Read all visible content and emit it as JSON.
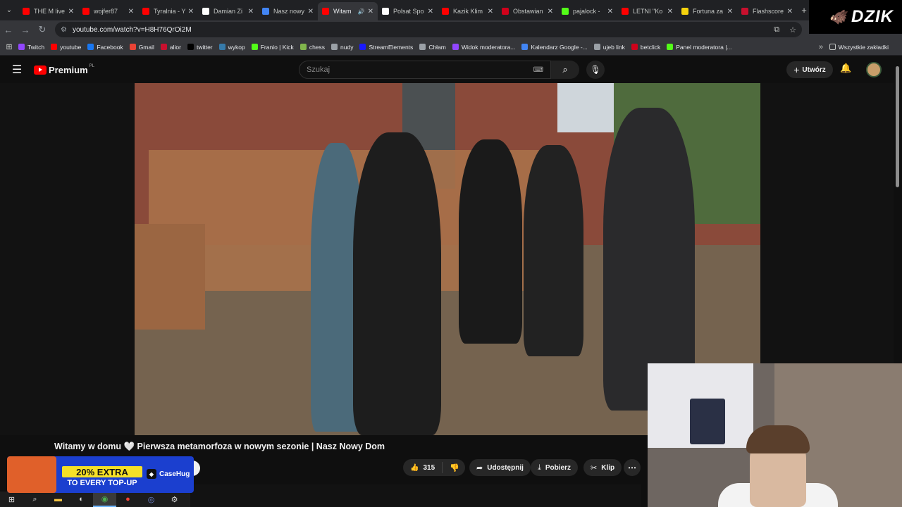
{
  "browser": {
    "tabs": [
      {
        "title": "THE M live",
        "icon": "youtube-icon",
        "color": "#ff0000"
      },
      {
        "title": "wojfer87",
        "icon": "youtube-icon",
        "color": "#ff0000"
      },
      {
        "title": "Tyralnia - Y",
        "icon": "youtube-icon",
        "color": "#ff0000"
      },
      {
        "title": "Damian Zi",
        "icon": "x-icon",
        "color": "#ffffff"
      },
      {
        "title": "Nasz nowy",
        "icon": "google-icon",
        "color": "#4285f4"
      },
      {
        "title": "Witam",
        "icon": "youtube-icon",
        "color": "#ff0000",
        "active": true
      },
      {
        "title": "Polsat Spo",
        "icon": "x-icon",
        "color": "#ffffff"
      },
      {
        "title": "Kazik Klim",
        "icon": "youtube-icon",
        "color": "#ff0000"
      },
      {
        "title": "Obstawian",
        "icon": "betclick-icon",
        "color": "#d0021b"
      },
      {
        "title": "pajalock -",
        "icon": "kick-icon",
        "color": "#53fc18"
      },
      {
        "title": "LETNI \"Ko",
        "icon": "youtube-icon",
        "color": "#ff0000"
      },
      {
        "title": "Fortuna za",
        "icon": "fortuna-icon",
        "color": "#f5d30d"
      },
      {
        "title": "Flashscore",
        "icon": "flashscore-icon",
        "color": "#c8102e"
      }
    ],
    "brand_badge": "DZIK",
    "url": "youtube.com/watch?v=H8H76QrOi2M",
    "bookmarks": [
      {
        "label": "Twitch",
        "icon": "twitch-icon",
        "color": "#9146ff"
      },
      {
        "label": "youtube",
        "icon": "youtube-icon",
        "color": "#ff0000"
      },
      {
        "label": "Facebook",
        "icon": "facebook-icon",
        "color": "#1877f2"
      },
      {
        "label": "Gmail",
        "icon": "gmail-icon",
        "color": "#ea4335"
      },
      {
        "label": "alior",
        "icon": "alior-icon",
        "color": "#c8102e"
      },
      {
        "label": "twitter",
        "icon": "x-icon",
        "color": "#000000"
      },
      {
        "label": "wykop",
        "icon": "wykop-icon",
        "color": "#367aa9"
      },
      {
        "label": "Franio | Kick",
        "icon": "kick-icon",
        "color": "#53fc18"
      },
      {
        "label": "chess",
        "icon": "chess-icon",
        "color": "#81b64c"
      },
      {
        "label": "nudy",
        "icon": "folder-icon",
        "color": "#9aa0a6"
      },
      {
        "label": "StreamElements",
        "icon": "streamelements-icon",
        "color": "#1a1aff"
      },
      {
        "label": "Chłam",
        "icon": "globe-icon",
        "color": "#9aa0a6"
      },
      {
        "label": "Widok moderatora...",
        "icon": "twitch-icon",
        "color": "#9146ff"
      },
      {
        "label": "Kalendarz Google -...",
        "icon": "calendar-icon",
        "color": "#4285f4"
      },
      {
        "label": "ujeb link",
        "icon": "globe-icon",
        "color": "#9aa0a6"
      },
      {
        "label": "betclick",
        "icon": "betclick-icon",
        "color": "#d0021b"
      },
      {
        "label": "Panel moderatora |...",
        "icon": "kick-icon",
        "color": "#53fc18"
      }
    ],
    "all_bookmarks": "Wszystkie zakładki"
  },
  "youtube": {
    "logo_text": "Premium",
    "logo_region": "PL",
    "search_placeholder": "Szukaj",
    "create_label": "Utwórz",
    "video_title": "Witamy w domu 🤍 Pierwsza metamorfoza w nowym sezonie | Nasz Nowy Dom",
    "like_count": "315",
    "share_label": "Udostępnij",
    "download_label": "Pobierz",
    "clip_label": "Klip"
  },
  "ad": {
    "headline": "20% EXTRA",
    "subline": "TO EVERY TOP-UP",
    "brand": "CaseHug"
  },
  "colors": {
    "youtube_red": "#ff0000",
    "ad_blue": "#1b3fcf",
    "ad_yellow": "#f5e027"
  }
}
